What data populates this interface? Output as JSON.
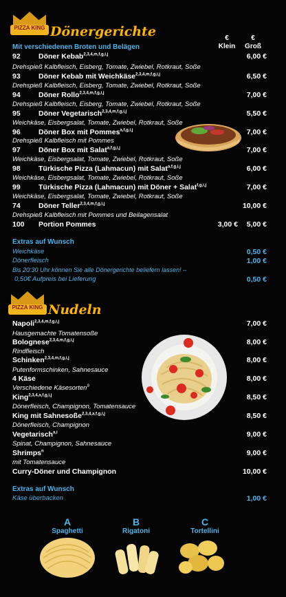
{
  "logo_text": "PIZZA KING",
  "doner": {
    "title": "Dönergerichte",
    "subtitle": "Mit verschiedenen Broten und Belägen",
    "col_small_cur": "€",
    "col_small": "Klein",
    "col_large_cur": "€",
    "col_large": "Groß",
    "items": [
      {
        "num": "92",
        "name": "Döner Kebab",
        "sup": "2,3,4,m,f,g,i,j",
        "small": "",
        "large": "6,00 €",
        "desc": "Drehspieß Kalbfleisch, Eisberg, Tomate, Zwiebel, Rotkraut, Soße"
      },
      {
        "num": "93",
        "name": "Döner Kebab mit Weichkäse",
        "sup": "2,3,4,m,f,g,i,j",
        "small": "",
        "large": "6,50 €",
        "desc": "Drehspieß Kalbfleisch, Eisberg, Tomate, Zwiebel, Rotkraut, Soße"
      },
      {
        "num": "94",
        "name": "Döner Rollo",
        "sup": "2,3,4,m,f,g,i,j",
        "small": "",
        "large": "7,00 €",
        "desc": "Drehspieß Kalbfleisch, Eisberg, Tomate, Zwiebel, Rotkraut, Soße"
      },
      {
        "num": "95",
        "name": "Döner Vegetarisch",
        "sup": "2,3,4,m,f,g,i,j",
        "small": "",
        "large": "5,50 €",
        "desc": "Weichkäse, Eisbergsalat, Tomate, Zwiebel, Rotkraut, Soße"
      },
      {
        "num": "96",
        "name": "Döner Box mit Pommes",
        "sup": "a,f,g,i,j",
        "small": "",
        "large": "7,00 €",
        "desc": "Drehspieß Kalbfleisch mit Pommes"
      },
      {
        "num": "97",
        "name": "Döner Box mit Salat",
        "sup": "a,f,g,i,j",
        "small": "",
        "large": "7,00 €",
        "desc": "Weichkäse, Eisbergsalat, Tomate, Zwiebel, Rotkraut, Soße"
      },
      {
        "num": "98",
        "name": "Türkische Pizza (Lahmacun) mit Salat",
        "sup": "a,f,g,i,j",
        "small": "",
        "large": "6,00 €",
        "desc": "Weichkäse, Eisbergsalat, Tomate, Zwiebel, Rotkraut, Soße"
      },
      {
        "num": "99",
        "name": "Türkische Pizza (Lahmacun) mit Döner + Salat",
        "sup": "f,g,i,j",
        "small": "",
        "large": "7,00 €",
        "desc": "Weichkäse, Eisbergsalat, Tomate, Zwiebel, Rotkraut, Soße"
      },
      {
        "num": "74",
        "name": "Döner Teller",
        "sup": "2,3,4,m,f,g,i,j",
        "small": "",
        "large": "10,00 €",
        "desc": "Drehspieß Kalbfleisch mit Pommes und Beilagensalat"
      },
      {
        "num": "100",
        "name": "Portion Pommes",
        "sup": "",
        "small": "3,00 €",
        "large": "5,00 €",
        "desc": ""
      }
    ],
    "extras_title": "Extras auf Wunsch",
    "extras": [
      {
        "name": "Weichkäse",
        "price": "0,50 €"
      },
      {
        "name": "Dönerfleisch",
        "price": "1,00 €"
      }
    ],
    "note1": "Bis 20:30 Uhr können Sie alle Dönergerichte beliefern lassen! –",
    "note2": "0,50€ Aufpreis bei Lieferung",
    "note2_price": "0,50 €"
  },
  "nudeln": {
    "title": "Nudeln",
    "items": [
      {
        "name": "Napoli",
        "sup": "2,3,4,m,f,g,i,j",
        "price": "7,00 €",
        "desc": "Hausgemachte Tomatensoße"
      },
      {
        "name": "Bolognese",
        "sup": "2,3,4,m,f,g,i,j",
        "price": "8,00 €",
        "desc": "Rindfleisch"
      },
      {
        "name": "Schinken",
        "sup": "2,3,4,m,f,g,i,j",
        "price": "8,00 €",
        "desc": "Putenformschinken, Sahnesauce"
      },
      {
        "name": "4 Käse",
        "sup": "",
        "price": "8,00 €",
        "desc": "Verschiedene Käsesorten",
        "desc_sup": "9"
      },
      {
        "name": "King",
        "sup": "2,3,4,a,f,g,i,j",
        "price": "8,50 €",
        "desc": "Dönerfleisch, Champignon, Tomatensauce"
      },
      {
        "name": "King mit Sahnesoße",
        "sup": "2,3,4,a,f,g,i,j",
        "price": "8,50 €",
        "desc": "Dönerfleisch, Champignon"
      },
      {
        "name": "Vegetarisch",
        "sup": "a,i",
        "price": "9,00 €",
        "desc": "Spinat, Champignon, Sahnesauce"
      },
      {
        "name": "Shrimps",
        "sup": "n",
        "price": "9,00 €",
        "desc": "mit Tomatensauce"
      },
      {
        "name": "Curry-Döner und Champignon",
        "sup": "",
        "price": "10,00 €",
        "desc": ""
      }
    ],
    "extras_title": "Extras auf Wunsch",
    "extras": [
      {
        "name": "Käse überbacken",
        "price": "1,00 €"
      }
    ]
  },
  "pasta_types": [
    {
      "letter": "A",
      "name": "Spaghetti"
    },
    {
      "letter": "B",
      "name": "Rigatoni"
    },
    {
      "letter": "C",
      "name": "Tortellini"
    }
  ],
  "colors": {
    "accent": "#ffb400",
    "blue": "#4fb3ea",
    "background": "#050505"
  }
}
